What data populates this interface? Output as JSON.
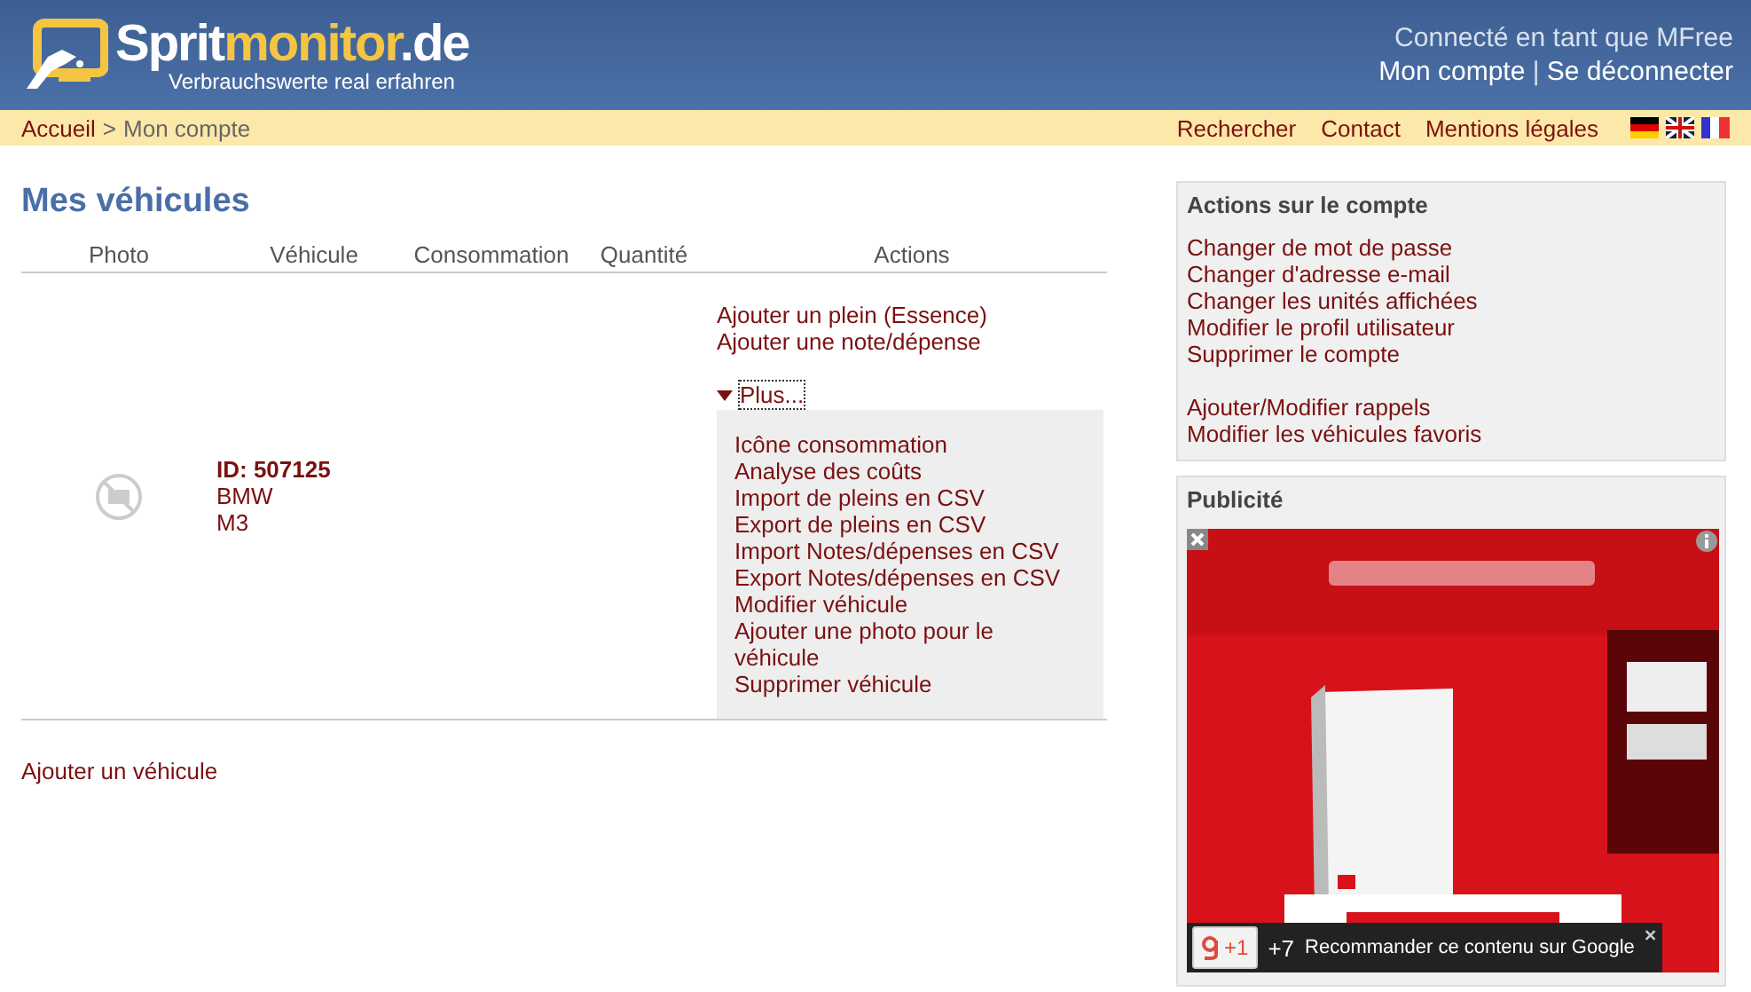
{
  "header": {
    "logo_parts": [
      {
        "text": "Sprit",
        "highlight": false
      },
      {
        "text": "monitor",
        "highlight": true
      },
      {
        "text": ".de",
        "highlight": false
      }
    ],
    "tagline": "Verbrauchswerte real erfahren",
    "logged_in_as": "Connecté en tant que MFree",
    "user_links": [
      "Mon compte",
      "Se déconnecter"
    ],
    "user_separator": "|"
  },
  "nav_bar": {
    "breadcrumb": [
      {
        "label": "Accueil",
        "link": true
      },
      {
        "label": "Mon compte",
        "link": false
      }
    ],
    "breadcrumb_separator": ">",
    "links": [
      "Rechercher",
      "Contact",
      "Mentions légales"
    ],
    "flags": [
      {
        "kind": "de"
      },
      {
        "kind": "en"
      },
      {
        "kind": "fr"
      }
    ]
  },
  "main": {
    "title": "Mes véhicules",
    "columns": [
      "Photo",
      "Véhicule",
      "Consommation",
      "Quantité",
      "Actions"
    ],
    "vehicles": [
      {
        "id": "ID: 507125",
        "make": "BMW",
        "model": "M3",
        "actions": [
          "Ajouter un plein (Essence)",
          "Ajouter une note/dépense"
        ],
        "more": {
          "label": "Plus...",
          "expanded": true,
          "items": [
            "Icône consommation",
            "Analyse des coûts",
            "Import de pleins en CSV",
            "Export de pleins en CSV",
            "Import Notes/dépenses en CSV",
            "Export Notes/dépenses en CSV",
            "Modifier véhicule",
            "Ajouter une photo pour le véhicule",
            "Supprimer véhicule"
          ]
        }
      }
    ],
    "add_vehicle": "Ajouter un véhicule"
  },
  "sidebar": {
    "account_actions": {
      "title": "Actions sur le compte",
      "groups": [
        [
          "Changer de mot de passe",
          "Changer d'adresse e-mail",
          "Changer les unités affichées",
          "Modifier le profil utilisateur",
          "Supprimer le compte"
        ],
        [
          "Ajouter/Modifier rappels",
          "Modifier les véhicules favoris"
        ]
      ]
    },
    "ad": {
      "title": "Publicité",
      "kind": "picture",
      "plus_one": "+1",
      "count": "+7",
      "recommend": "Recommander ce contenu sur Google"
    }
  }
}
